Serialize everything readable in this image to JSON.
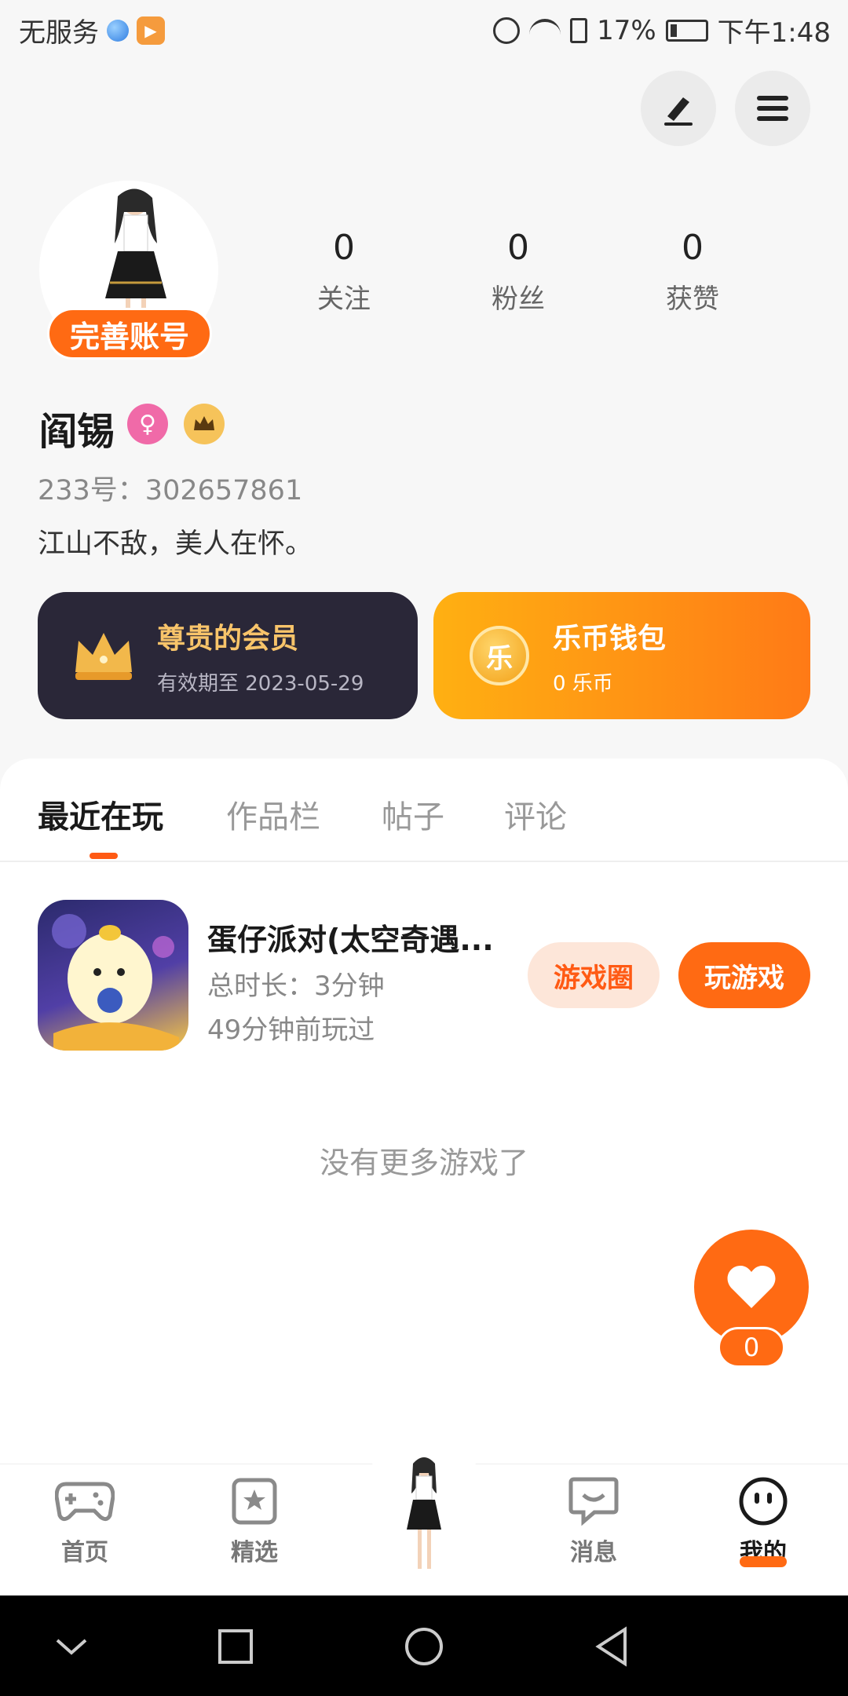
{
  "status_bar": {
    "carrier": "无服务",
    "battery": "17%",
    "time": "下午1:48"
  },
  "header": {
    "edit_icon": "pencil-icon",
    "menu_icon": "hamburger-menu-icon"
  },
  "profile": {
    "complete_label": "完善账号",
    "stats": [
      {
        "value": "0",
        "label": "关注"
      },
      {
        "value": "0",
        "label": "粉丝"
      },
      {
        "value": "0",
        "label": "获赞"
      }
    ],
    "username": "阎锡",
    "uid": "233号：302657861",
    "bio": "江山不敌，美人在怀。"
  },
  "cards": {
    "vip": {
      "title": "尊贵的会员",
      "subtitle": "有效期至 2023-05-29"
    },
    "wallet": {
      "title": "乐币钱包",
      "subtitle": "0 乐币",
      "coin_glyph": "乐"
    }
  },
  "tabs": [
    {
      "label": "最近在玩",
      "active": true
    },
    {
      "label": "作品栏",
      "active": false
    },
    {
      "label": "帖子",
      "active": false
    },
    {
      "label": "评论",
      "active": false
    }
  ],
  "recent_games": [
    {
      "title": "蛋仔派对(太空奇遇...",
      "duration": "总时长：3分钟",
      "last_played": "49分钟前玩过",
      "circle_label": "游戏圈",
      "play_label": "玩游戏"
    }
  ],
  "no_more_text": "没有更多游戏了",
  "like": {
    "count": "0"
  },
  "bottom_nav": [
    {
      "label": "首页",
      "icon": "gamepad-icon"
    },
    {
      "label": "精选",
      "icon": "star-bookmark-icon"
    },
    {
      "label": "",
      "icon": "avatar-figure"
    },
    {
      "label": "消息",
      "icon": "chat-bubble-icon"
    },
    {
      "label": "我的",
      "icon": "smiley-face-icon",
      "active": true
    }
  ],
  "colors": {
    "accent": "#ff6a13",
    "vip_bg": "#2a2738",
    "vip_gold": "#f8c46a"
  }
}
